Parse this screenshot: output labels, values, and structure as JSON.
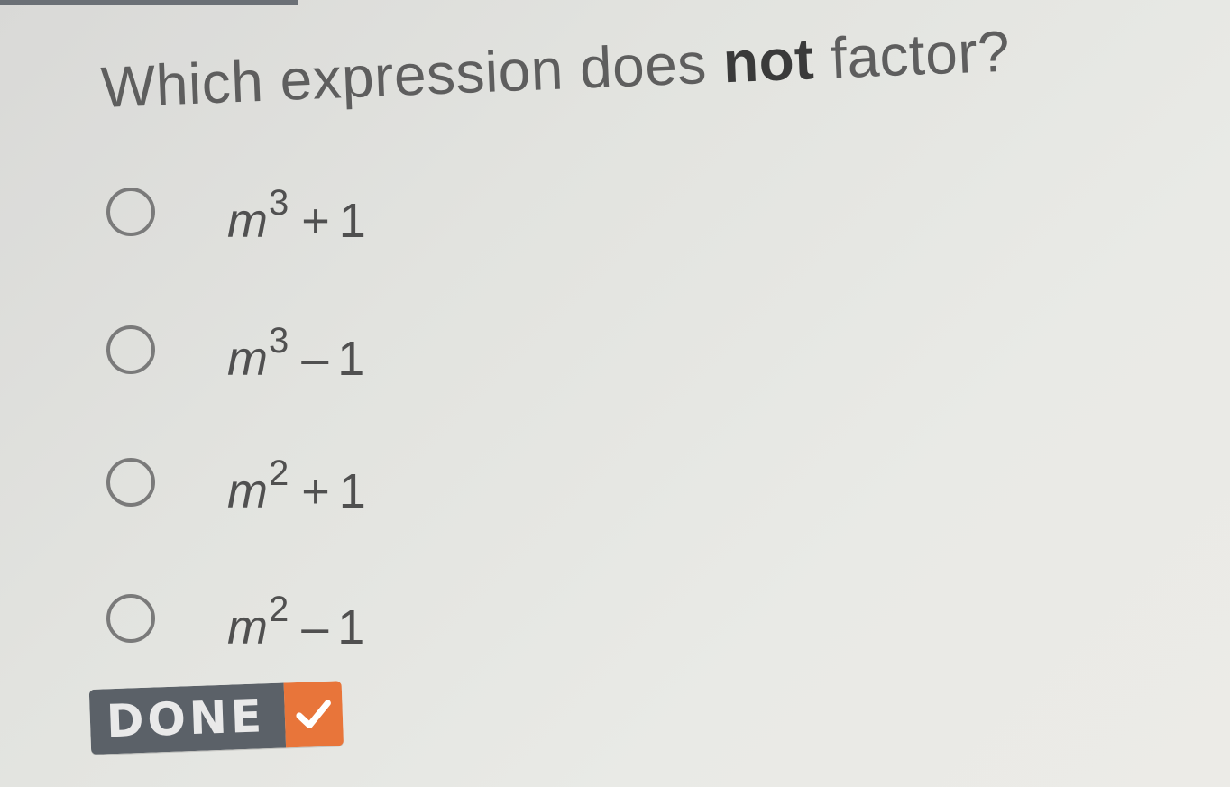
{
  "question": {
    "prefix": "Which expression does ",
    "emphasis": "not",
    "suffix": " factor?"
  },
  "options": [
    {
      "base": "m",
      "exponent": "3",
      "operator": "+",
      "constant": "1"
    },
    {
      "base": "m",
      "exponent": "3",
      "operator": "–",
      "constant": "1"
    },
    {
      "base": "m",
      "exponent": "2",
      "operator": "+",
      "constant": "1"
    },
    {
      "base": "m",
      "exponent": "2",
      "operator": "–",
      "constant": "1"
    }
  ],
  "done_button": {
    "label": "DONE",
    "icon": "checkmark-icon"
  },
  "colors": {
    "done_label_bg": "#5b6168",
    "done_check_bg": "#e8753a",
    "check_color": "#ffffff"
  }
}
